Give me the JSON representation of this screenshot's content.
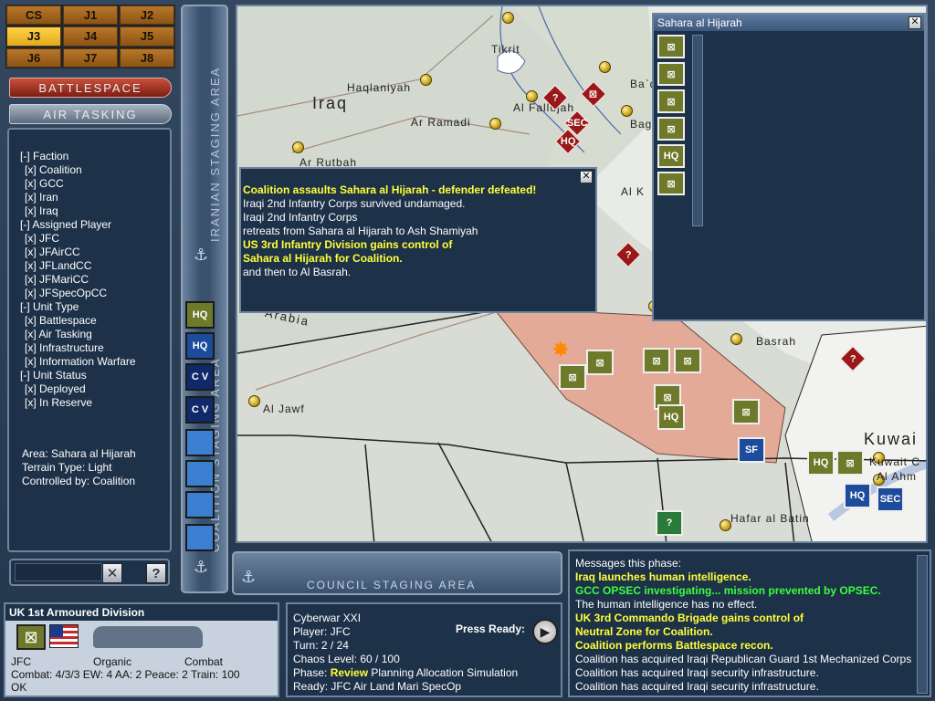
{
  "players": [
    {
      "label": "CS",
      "active": false
    },
    {
      "label": "J1",
      "active": false
    },
    {
      "label": "J2",
      "active": false
    },
    {
      "label": "J3",
      "active": true
    },
    {
      "label": "J4",
      "active": false
    },
    {
      "label": "J5",
      "active": false
    },
    {
      "label": "J6",
      "active": false
    },
    {
      "label": "J7",
      "active": false
    },
    {
      "label": "J8",
      "active": false
    }
  ],
  "modes": {
    "battlespace": "Battlespace",
    "air_tasking": "Air Tasking"
  },
  "filters": [
    {
      "text": "[-] Faction",
      "sub": false
    },
    {
      "text": "[x] Coalition",
      "sub": true
    },
    {
      "text": "[x] GCC",
      "sub": true
    },
    {
      "text": "[x] Iran",
      "sub": true
    },
    {
      "text": "[x] Iraq",
      "sub": true
    },
    {
      "text": "[-] Assigned Player",
      "sub": false
    },
    {
      "text": "[x] JFC",
      "sub": true
    },
    {
      "text": "[x] JFAirCC",
      "sub": true
    },
    {
      "text": "[x] JFLandCC",
      "sub": true
    },
    {
      "text": "[x] JFMariCC",
      "sub": true
    },
    {
      "text": "[x] JFSpecOpCC",
      "sub": true
    },
    {
      "text": "[-] Unit Type",
      "sub": false
    },
    {
      "text": "[x] Battlespace",
      "sub": true
    },
    {
      "text": "[x] Air Tasking",
      "sub": true
    },
    {
      "text": "[x] Infrastructure",
      "sub": true
    },
    {
      "text": "[x] Information Warfare",
      "sub": true
    },
    {
      "text": "[-] Unit Status",
      "sub": false
    },
    {
      "text": "[x] Deployed",
      "sub": true
    },
    {
      "text": "[x] In Reserve",
      "sub": true
    }
  ],
  "area_info": {
    "area": "Area:  Sahara al Hijarah",
    "terrain": "Terrain Type:  Light",
    "controlled": "Controlled by:  Coalition"
  },
  "staging": {
    "iranian": "IRANIAN STAGING AREA",
    "coalition": "COALITION STAGING AREA",
    "council": "COUNCIL STAGING AREA"
  },
  "staging_units": [
    "HQ",
    "HQ",
    "C V",
    "C V",
    "",
    "",
    "",
    ""
  ],
  "map": {
    "countries": {
      "iraq": "Iraq",
      "arabia": "Arabia",
      "kuwait": "Kuwai"
    },
    "cities": [
      "Tikrit",
      "Haqlaniyah",
      "Al Fallujah",
      "Ba`qub",
      "Baghdad",
      "Ar Ramadi",
      "Ar Rutbah",
      "Al K",
      "Basrah",
      "Al Jawf",
      "Hafar al Batin",
      "Kuwait C",
      "Al Ahm"
    ],
    "unit_labels": [
      "SEC",
      "HQ",
      "SF",
      "HQ",
      "HQ",
      "HQ",
      "SEC"
    ],
    "question_mark": "?"
  },
  "combat_log": [
    {
      "text": "Coalition assaults Sahara al Hijarah - defender defeated!",
      "style": "yellow"
    },
    {
      "text": "Iraqi 2nd Infantry Corps survived undamaged.",
      "style": ""
    },
    {
      "text": "Iraqi 2nd Infantry Corps",
      "style": ""
    },
    {
      "text": "retreats from Sahara al Hijarah to Ash Shamiyah",
      "style": ""
    },
    {
      "text": "US 3rd Infantry Division gains control of",
      "style": "yellow"
    },
    {
      "text": " Sahara al Hijarah for Coalition.",
      "style": "yellow"
    },
    {
      "text": " and then to Al Basrah.",
      "style": ""
    }
  ],
  "area_popup": {
    "title": "Sahara al Hijarah",
    "close": "✕",
    "stack_hq": "HQ"
  },
  "unit_panel": {
    "name": "UK 1st Armoured Division",
    "owner": "JFC",
    "organic": "Organic",
    "role": "Combat",
    "stats": "Combat: 4/3/3   EW: 4   AA: 2   Peace: 2   Train: 100",
    "state": "OK"
  },
  "status": {
    "game": "Cyberwar XXI",
    "player": "Player: JFC",
    "turn": "Turn: 2 / 24",
    "chaos": "Chaos Level: 60 / 100",
    "phase_label": "Phase:",
    "phase_current": "Review",
    "phase_rest": "Planning  Allocation  Simulation",
    "ready": "Ready: JFC  Air  Land  Mari  SpecOp",
    "press_ready": "Press Ready:"
  },
  "messages": [
    {
      "text": "Messages this phase:",
      "style": ""
    },
    {
      "text": "Iraq launches human intelligence.",
      "style": "yellow"
    },
    {
      "text": "GCC OPSEC investigating... mission prevented by OPSEC.",
      "style": "green"
    },
    {
      "text": "The human intelligence has no effect.",
      "style": ""
    },
    {
      "text": "UK 3rd Commando Brigade gains control of",
      "style": "yellow"
    },
    {
      "text": " Neutral Zone for Coalition.",
      "style": "yellow"
    },
    {
      "text": "Coalition performs Battlespace recon.",
      "style": "yellow"
    },
    {
      "text": "Coalition has acquired Iraqi Republican Guard 1st Mechanized Corps",
      "style": ""
    },
    {
      "text": "Coalition has acquired Iraqi security infrastructure.",
      "style": ""
    },
    {
      "text": "Coalition has acquired Iraqi security infrastructure.",
      "style": ""
    }
  ],
  "search": {
    "placeholder": ""
  },
  "colors": {
    "accent": "#e2a91a",
    "panel": "#1d3149",
    "highlight": "#ffff3a",
    "ok": "#3aff3a"
  }
}
